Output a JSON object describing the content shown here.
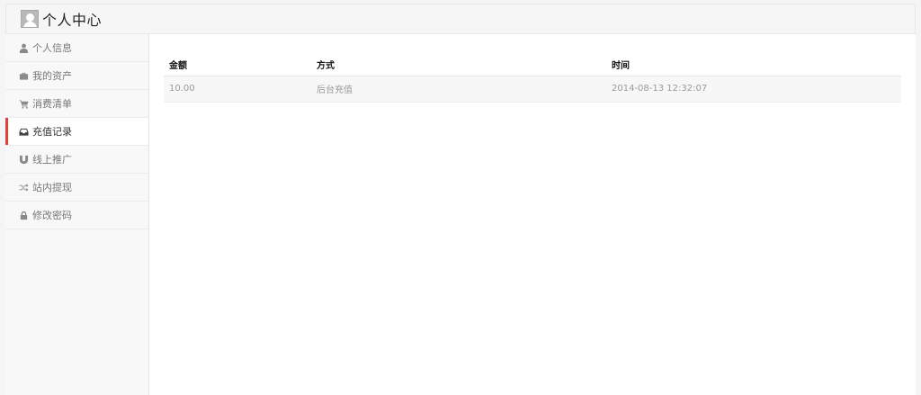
{
  "header": {
    "title": "个人中心",
    "avatar_icon": "user-avatar-icon"
  },
  "sidebar": {
    "active_index": 3,
    "accent_color": "#e0403a",
    "items": [
      {
        "label": "个人信息",
        "icon": "user-icon"
      },
      {
        "label": "我的资产",
        "icon": "briefcase-icon"
      },
      {
        "label": "消费清单",
        "icon": "cart-icon"
      },
      {
        "label": "充值记录",
        "icon": "inbox-icon"
      },
      {
        "label": "线上推广",
        "icon": "magnet-icon"
      },
      {
        "label": "站内提现",
        "icon": "shuffle-icon"
      },
      {
        "label": "修改密码",
        "icon": "lock-icon"
      }
    ]
  },
  "records": {
    "columns": [
      "金额",
      "方式",
      "时间"
    ],
    "rows": [
      [
        "10.00",
        "后台充值",
        "2014-08-13 12:32:07"
      ]
    ]
  }
}
